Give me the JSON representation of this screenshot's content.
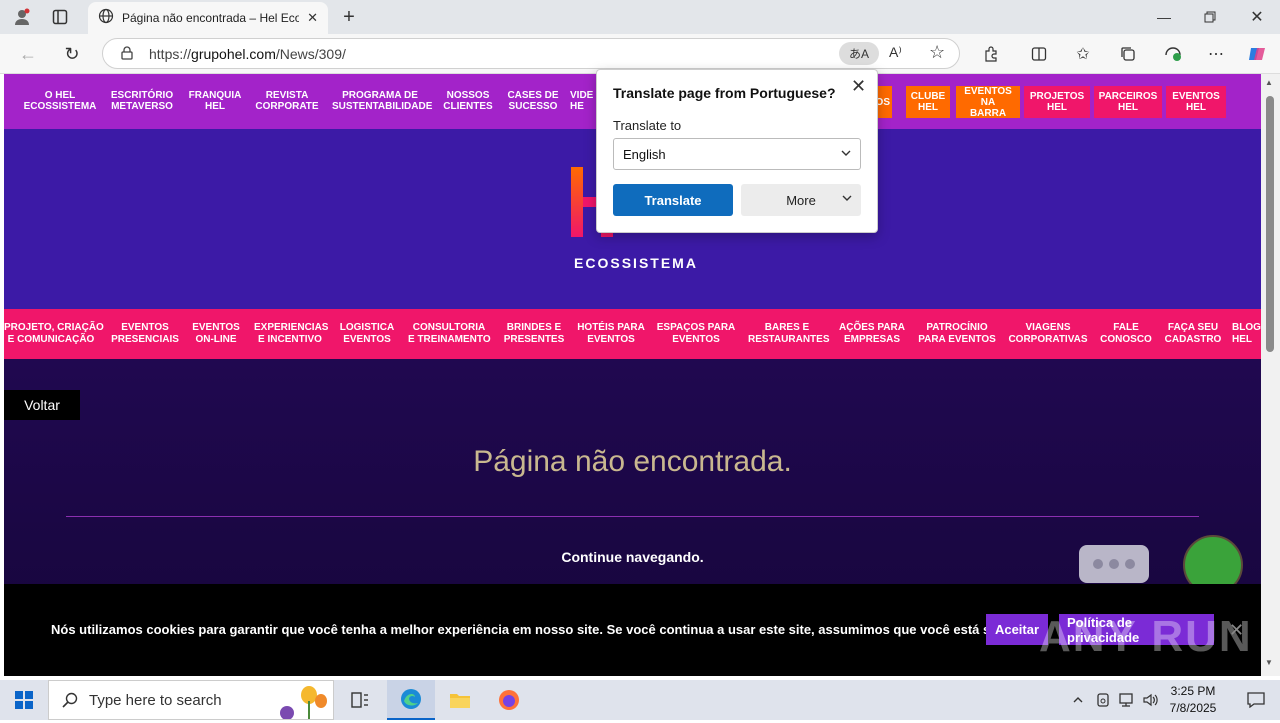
{
  "browser": {
    "tab_title": "Página não encontrada – Hel Ecossistema",
    "url_prefix": "https://",
    "url_host": "grupohel.com",
    "url_path": "/News/309/"
  },
  "top_nav": [
    {
      "line1": "O HEL",
      "line2": "ECOSSISTEMA"
    },
    {
      "line1": "ESCRITÓRIO",
      "line2": "METAVERSO"
    },
    {
      "line1": "FRANQUIA",
      "line2": "HEL"
    },
    {
      "line1": "REVISTA",
      "line2": "CORPORATE"
    },
    {
      "line1": "PROGRAMA DE",
      "line2": "SUSTENTABILIDADE"
    },
    {
      "line1": "NOSSOS",
      "line2": "CLIENTES"
    },
    {
      "line1": "CASES DE",
      "line2": "SUCESSO"
    },
    {
      "line1": "VIDE",
      "line2": "HE"
    }
  ],
  "top_nav_buttons": [
    {
      "line1": "COS",
      "line2": "",
      "color": "#ff6a00"
    },
    {
      "line1": "CLUBE",
      "line2": "HEL",
      "color": "#ff6a00"
    },
    {
      "line1": "EVENTOS",
      "line2": "NA BARRA",
      "color": "#ff6a00"
    },
    {
      "line1": "PROJETOS",
      "line2": "HEL",
      "color": "#f0166a"
    },
    {
      "line1": "PARCEIROS",
      "line2": "HEL",
      "color": "#f0166a"
    },
    {
      "line1": "EVENTOS",
      "line2": "HEL",
      "color": "#f0166a"
    }
  ],
  "logo_text": "ECOSSISTEMA",
  "sub_nav": [
    {
      "line1": "PROJETO, CRIAÇÃO",
      "line2": "E COMUNICAÇÃO"
    },
    {
      "line1": "EVENTOS",
      "line2": "PRESENCIAIS"
    },
    {
      "line1": "EVENTOS",
      "line2": "ON-LINE"
    },
    {
      "line1": "EXPERIENCIAS",
      "line2": "E INCENTIVO"
    },
    {
      "line1": "LOGISTICA",
      "line2": "EVENTOS"
    },
    {
      "line1": "CONSULTORIA",
      "line2": "E TREINAMENTO"
    },
    {
      "line1": "BRINDES E",
      "line2": "PRESENTES"
    },
    {
      "line1": "HOTÉIS PARA",
      "line2": "EVENTOS"
    },
    {
      "line1": "ESPAÇOS PARA",
      "line2": "EVENTOS"
    },
    {
      "line1": "BARES E",
      "line2": "RESTAURANTES"
    },
    {
      "line1": "AÇÕES PARA",
      "line2": "EMPRESAS"
    },
    {
      "line1": "PATROCÍNIO",
      "line2": "PARA EVENTOS"
    },
    {
      "line1": "VIAGENS",
      "line2": "CORPORATIVAS"
    },
    {
      "line1": "FALE",
      "line2": "CONOSCO"
    },
    {
      "line1": "FAÇA SEU",
      "line2": "CADASTRO"
    },
    {
      "line1": "BLOG",
      "line2": "HEL"
    }
  ],
  "main": {
    "back_label": "Voltar",
    "heading": "Página não encontrada.",
    "continue_text": "Continue navegando."
  },
  "cookie": {
    "text": "Nós utilizamos cookies para garantir que você tenha a melhor experiência em nosso site. Se você continua a usar este site, assumimos que você está satisfeito.",
    "accept_label": "Aceitar",
    "privacy_label": "Política de privacidade",
    "close_glyph": "✕"
  },
  "watermark": "ANY RUN",
  "translate_popup": {
    "title": "Translate page from Portuguese?",
    "label": "Translate to",
    "selected_language": "English",
    "translate_label": "Translate",
    "more_label": "More"
  },
  "taskbar": {
    "search_placeholder": "Type here to search",
    "time": "3:25 PM",
    "date": "7/8/2025"
  },
  "colors": {
    "top_nav_bg": "#a323c9",
    "hero_bg": "#3c1aa6",
    "sub_nav_bg": "#f0166a",
    "accent_button": "#7b2bd6",
    "translate_button": "#0f6cbd"
  }
}
